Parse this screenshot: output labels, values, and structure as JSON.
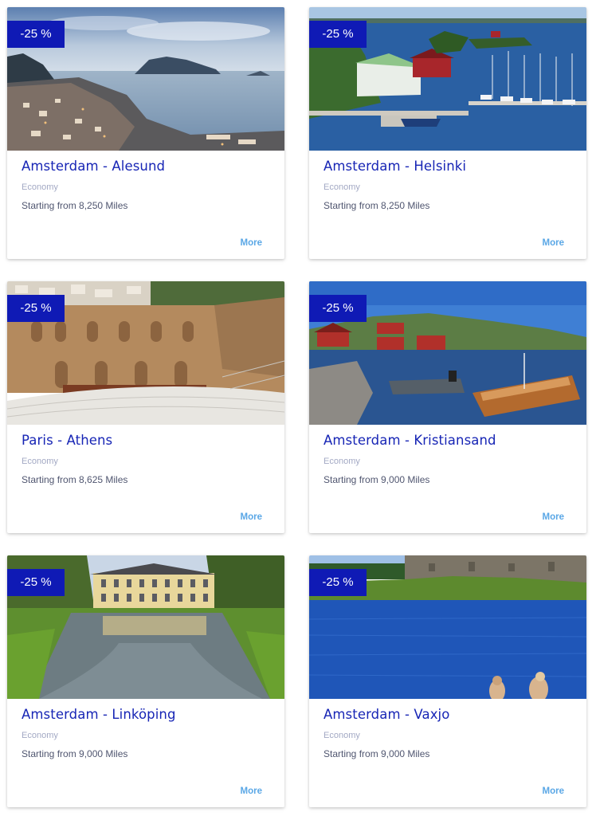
{
  "routes": [
    {
      "discount": "-25 %",
      "title": "Amsterdam - Alesund",
      "cabin": "Economy",
      "price": "Starting from 8,250 Miles",
      "more": "More"
    },
    {
      "discount": "-25 %",
      "title": "Amsterdam - Helsinki",
      "cabin": "Economy",
      "price": "Starting from 8,250 Miles",
      "more": "More"
    },
    {
      "discount": "-25 %",
      "title": "Paris - Athens",
      "cabin": "Economy",
      "price": "Starting from 8,625 Miles",
      "more": "More"
    },
    {
      "discount": "-25 %",
      "title": "Amsterdam - Kristiansand",
      "cabin": "Economy",
      "price": "Starting from 9,000 Miles",
      "more": "More"
    },
    {
      "discount": "-25 %",
      "title": "Amsterdam - Linköping",
      "cabin": "Economy",
      "price": "Starting from 9,000 Miles",
      "more": "More"
    },
    {
      "discount": "-25 %",
      "title": "Amsterdam - Vaxjo",
      "cabin": "Economy",
      "price": "Starting from 9,000 Miles",
      "more": "More"
    }
  ],
  "colors": {
    "badge": "#0f1ab5",
    "title": "#1725b5",
    "more_link": "#5aa7e6",
    "cabin_text": "#a3a9c4",
    "price_text": "#505670"
  }
}
